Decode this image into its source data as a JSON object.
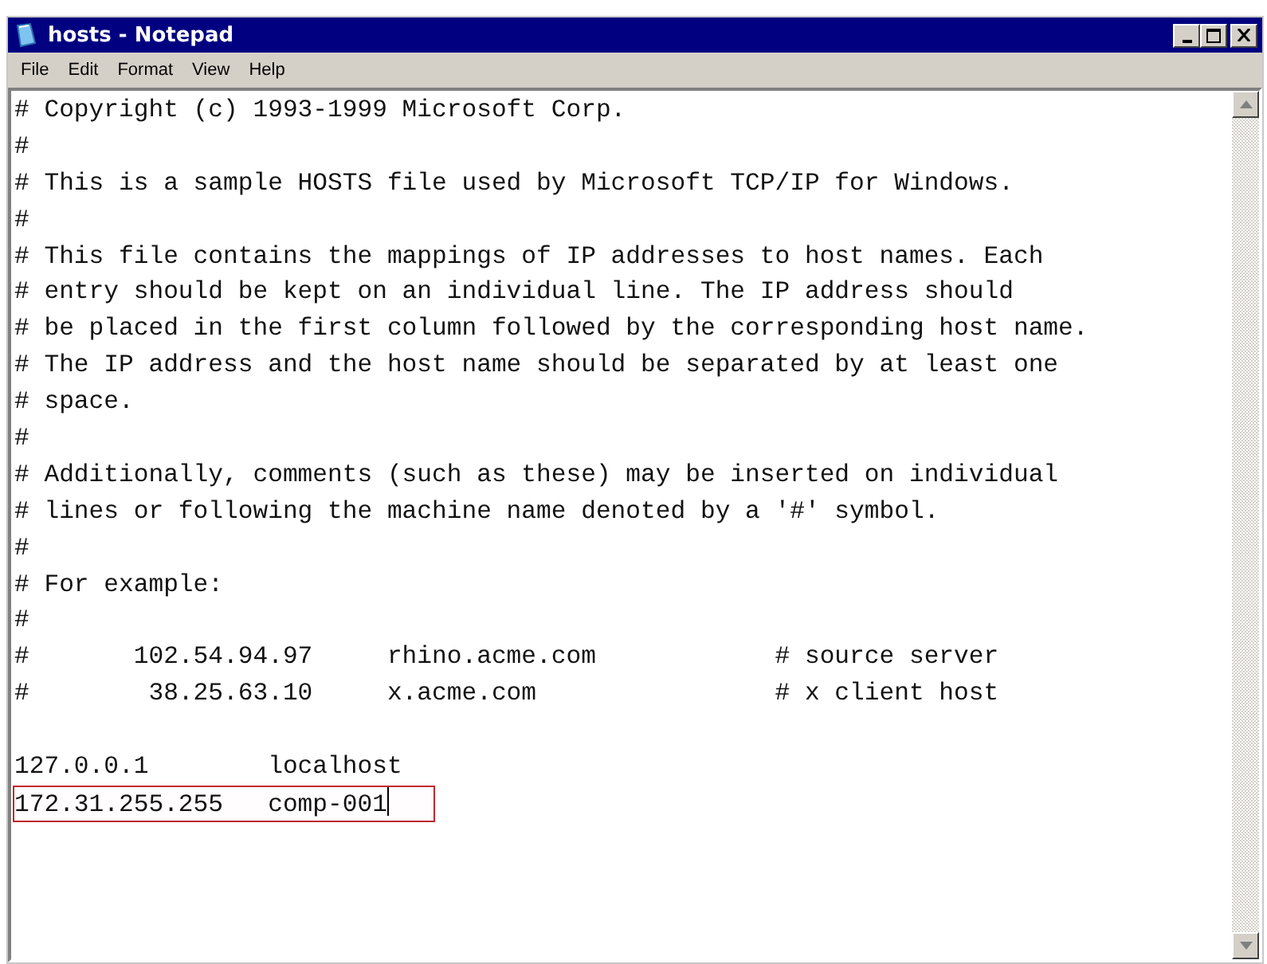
{
  "window": {
    "title": "hosts - Notepad"
  },
  "menu": [
    {
      "label": "File"
    },
    {
      "label": "Edit"
    },
    {
      "label": "Format"
    },
    {
      "label": "View"
    },
    {
      "label": "Help"
    }
  ],
  "editor": {
    "lines": [
      {
        "text": "# Copyright (c) 1993-1999 Microsoft Corp.",
        "highlighted": false,
        "caret": false
      },
      {
        "text": "#",
        "highlighted": false,
        "caret": false
      },
      {
        "text": "# This is a sample HOSTS file used by Microsoft TCP/IP for Windows.",
        "highlighted": false,
        "caret": false
      },
      {
        "text": "#",
        "highlighted": false,
        "caret": false
      },
      {
        "text": "# This file contains the mappings of IP addresses to host names. Each",
        "highlighted": false,
        "caret": false
      },
      {
        "text": "# entry should be kept on an individual line. The IP address should",
        "highlighted": false,
        "caret": false
      },
      {
        "text": "# be placed in the first column followed by the corresponding host name.",
        "highlighted": false,
        "caret": false
      },
      {
        "text": "# The IP address and the host name should be separated by at least one",
        "highlighted": false,
        "caret": false
      },
      {
        "text": "# space.",
        "highlighted": false,
        "caret": false
      },
      {
        "text": "#",
        "highlighted": false,
        "caret": false
      },
      {
        "text": "# Additionally, comments (such as these) may be inserted on individual",
        "highlighted": false,
        "caret": false
      },
      {
        "text": "# lines or following the machine name denoted by a '#' symbol.",
        "highlighted": false,
        "caret": false
      },
      {
        "text": "#",
        "highlighted": false,
        "caret": false
      },
      {
        "text": "# For example:",
        "highlighted": false,
        "caret": false
      },
      {
        "text": "#",
        "highlighted": false,
        "caret": false
      },
      {
        "text": "#       102.54.94.97     rhino.acme.com            # source server",
        "highlighted": false,
        "caret": false
      },
      {
        "text": "#        38.25.63.10     x.acme.com                # x client host",
        "highlighted": false,
        "caret": false
      },
      {
        "highlighted": false,
        "caret": false
      },
      {
        "text": "127.0.0.1        localhost",
        "highlighted": false,
        "caret": false
      },
      {
        "text": "172.31.255.255   comp-001",
        "highlighted": true,
        "caret": true
      }
    ]
  }
}
